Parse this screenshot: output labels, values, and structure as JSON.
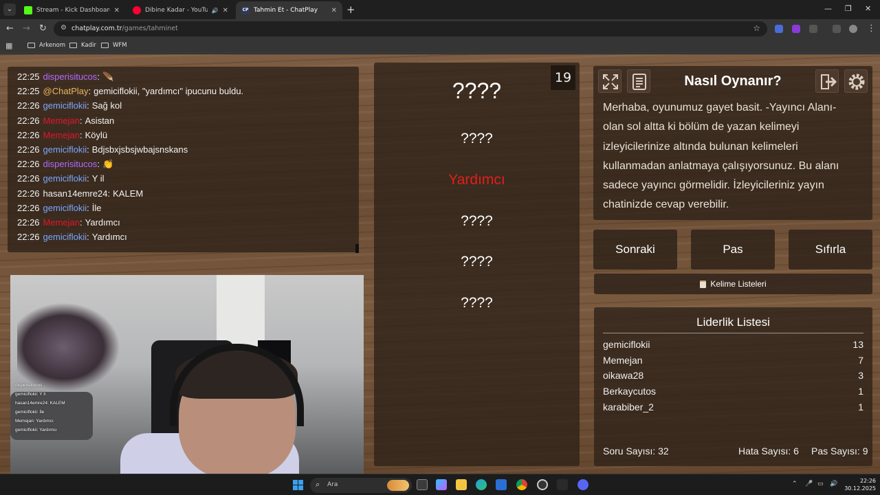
{
  "browser": {
    "tabs": [
      {
        "title": "Stream - Kick Dashboard",
        "favicon": "K",
        "color": "#53fc18"
      },
      {
        "title": "Dibine Kadar - YouTube Mu",
        "favicon": "▶",
        "color": "#ff0033"
      },
      {
        "title": "Tahmin Et - ChatPlay",
        "favicon": "CP",
        "color": "#4a7cff"
      }
    ],
    "url_host": "chatplay.com.tr",
    "url_path": "/games/tahminet",
    "bookmarks": [
      "Arkenom",
      "Kadir",
      "WFM"
    ]
  },
  "chat": [
    {
      "time": "22:25",
      "user": "disperisitucos",
      "sep": ":",
      "message": "🪶",
      "color": "#b06bff"
    },
    {
      "time": "22:25",
      "user": "@ChatPlay",
      "sep": ":",
      "message": "gemiciflokii, \"yardımcı\" ipucunu buldu.",
      "color": "#e8b85a"
    },
    {
      "time": "22:26",
      "user": "gemiciflokii",
      "sep": ":",
      "message": "Sağ kol",
      "color": "#7aa7ff"
    },
    {
      "time": "22:26",
      "user": "Memejan",
      "sep": ":",
      "message": "Asistan",
      "color": "#e0162b"
    },
    {
      "time": "22:26",
      "user": "Memejan",
      "sep": ":",
      "message": "Köylü",
      "color": "#e0162b"
    },
    {
      "time": "22:26",
      "user": "gemiciflokii",
      "sep": ":",
      "message": "Bdjsbxjsbsjwbajsnskans",
      "color": "#7aa7ff"
    },
    {
      "time": "22:26",
      "user": "disperisitucos",
      "sep": ":",
      "message": "👏",
      "color": "#b06bff"
    },
    {
      "time": "22:26",
      "user": "gemiciflokii",
      "sep": ":",
      "message": "Y il",
      "color": "#7aa7ff"
    },
    {
      "time": "22:26",
      "user": "hasan14emre24",
      "sep": ":",
      "message": "KALEM",
      "color": "#f2f2f2"
    },
    {
      "time": "22:26",
      "user": "gemiciflokii",
      "sep": ":",
      "message": "İle",
      "color": "#7aa7ff"
    },
    {
      "time": "22:26",
      "user": "Memejan",
      "sep": ":",
      "message": "Yardımcı",
      "color": "#e0162b"
    },
    {
      "time": "22:26",
      "user": "gemiciflokii",
      "sep": ":",
      "message": "Yardımcı",
      "color": "#7aa7ff"
    }
  ],
  "overlay_chat": [
    "disperisitucos",
    "gemiciflokii: Y il",
    "hasan14emre24: KALEM",
    "gemiciflokii: İle",
    "Memejan: Yardımcı",
    "gemiciflokii: Yardımcı"
  ],
  "game": {
    "counter": "19",
    "words": [
      "????",
      "????",
      "Yardımcı",
      "????",
      "????",
      "????"
    ]
  },
  "howto": {
    "title": "Nasıl Oynanır?",
    "lines": [
      "Merhaba, oyunumuz gayet basit. -Yayıncı Alanı-",
      "olan sol altta ki bölüm de yazan kelimeyi",
      "izleyicilerinize altında bulunan kelimeleri",
      "kullanmadan anlatmaya çalışıyorsunuz. Bu alanı",
      "sadece yayıncı görmelidir. İzleyicileriniz yayın",
      "chatinizde cevap verebilir."
    ]
  },
  "actions": {
    "next": "Sonraki",
    "pass": "Pas",
    "reset": "Sıfırla",
    "lists": "Kelime Listeleri"
  },
  "leaderboard": {
    "title": "Liderlik Listesi",
    "rows": [
      {
        "name": "gemiciflokii",
        "score": "13"
      },
      {
        "name": "Memejan",
        "score": "7"
      },
      {
        "name": "oikawa28",
        "score": "3"
      },
      {
        "name": "Berkaycutos",
        "score": "1"
      },
      {
        "name": "karabiber_2",
        "score": "1"
      }
    ]
  },
  "stats": {
    "questions": "Soru Sayısı: 32",
    "errors": "Hata Sayısı: 6",
    "passes": "Pas Sayısı: 9"
  },
  "taskbar": {
    "search_placeholder": "Ara",
    "time": "22:26",
    "date": "30.12.2025"
  }
}
